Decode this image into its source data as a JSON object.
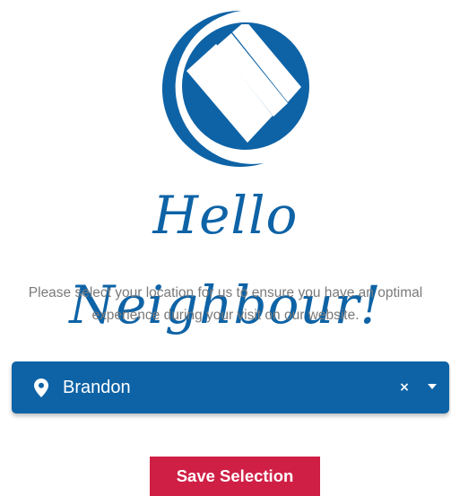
{
  "colors": {
    "brand_blue": "#0e63a6",
    "save_button": "#d01f45",
    "message_text": "#7a7a7a",
    "background": "#ffffff"
  },
  "header": {
    "logo_icon": "brand-logo-icon",
    "greeting": "Hello Neighbour!"
  },
  "message": {
    "text": "Please select your location for us to ensure you have an optimal experience during your visit on our website."
  },
  "location_select": {
    "icon": "map-pin-icon",
    "selected_value": "Brandon",
    "clear_label": "×",
    "dropdown_icon": "chevron-down-icon"
  },
  "actions": {
    "save_label": "Save Selection"
  }
}
